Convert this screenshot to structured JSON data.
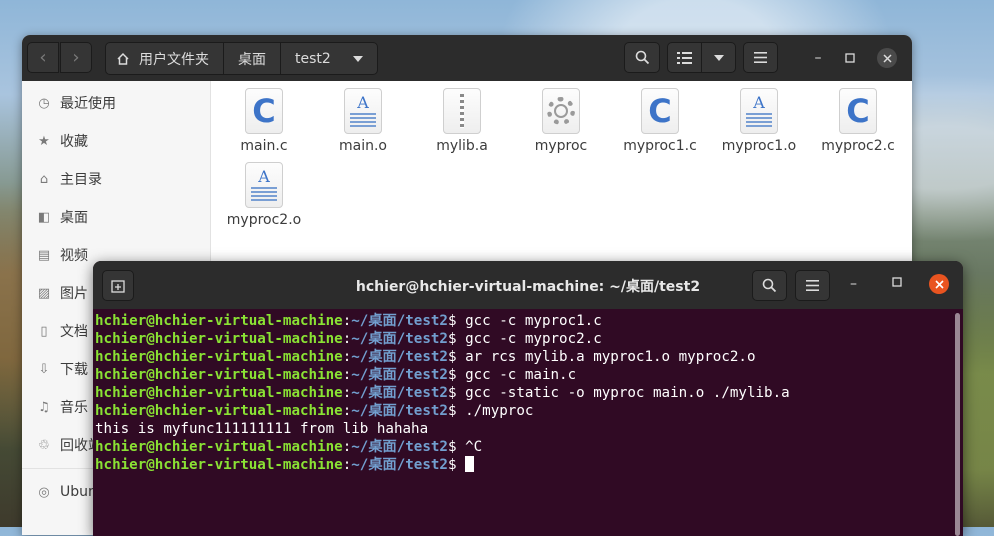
{
  "file_manager": {
    "pathbar": [
      "用户文件夹",
      "桌面",
      "test2"
    ],
    "sidebar": [
      {
        "label": "最近使用",
        "icon": "clock-icon"
      },
      {
        "label": "收藏",
        "icon": "star-icon"
      },
      {
        "label": "主目录",
        "icon": "home-icon"
      },
      {
        "label": "桌面",
        "icon": "desktop-icon"
      },
      {
        "label": "视频",
        "icon": "video-icon"
      },
      {
        "label": "图片",
        "icon": "picture-icon"
      },
      {
        "label": "文档",
        "icon": "document-icon"
      },
      {
        "label": "下载",
        "icon": "download-icon"
      },
      {
        "label": "音乐",
        "icon": "music-icon"
      },
      {
        "label": "回收站",
        "icon": "trash-icon"
      },
      {
        "label": "Ubuntu",
        "icon": "disc-icon"
      }
    ],
    "files": [
      {
        "name": "main.c",
        "type": "c-source"
      },
      {
        "name": "main.o",
        "type": "object"
      },
      {
        "name": "mylib.a",
        "type": "archive"
      },
      {
        "name": "myproc",
        "type": "executable"
      },
      {
        "name": "myproc1.c",
        "type": "c-source"
      },
      {
        "name": "myproc1.o",
        "type": "object"
      },
      {
        "name": "myproc2.c",
        "type": "c-source"
      },
      {
        "name": "myproc2.o",
        "type": "object"
      }
    ]
  },
  "terminal": {
    "title": "hchier@hchier-virtual-machine: ~/桌面/test2",
    "prompt_user": "hchier@hchier-virtual-machine",
    "prompt_path": "~/桌面/test2",
    "lines": [
      {
        "type": "cmd",
        "text": "gcc -c myproc1.c"
      },
      {
        "type": "cmd",
        "text": "gcc -c myproc2.c"
      },
      {
        "type": "cmd",
        "text": "ar rcs mylib.a myproc1.o myproc2.o"
      },
      {
        "type": "cmd",
        "text": "gcc -c main.c"
      },
      {
        "type": "cmd",
        "text": "gcc -static -o myproc main.o ./mylib.a"
      },
      {
        "type": "cmd",
        "text": "./myproc"
      },
      {
        "type": "out",
        "text": "this is myfunc111111111 from lib hahaha"
      },
      {
        "type": "cmd",
        "text": "^C"
      },
      {
        "type": "cmd",
        "text": ""
      }
    ]
  }
}
